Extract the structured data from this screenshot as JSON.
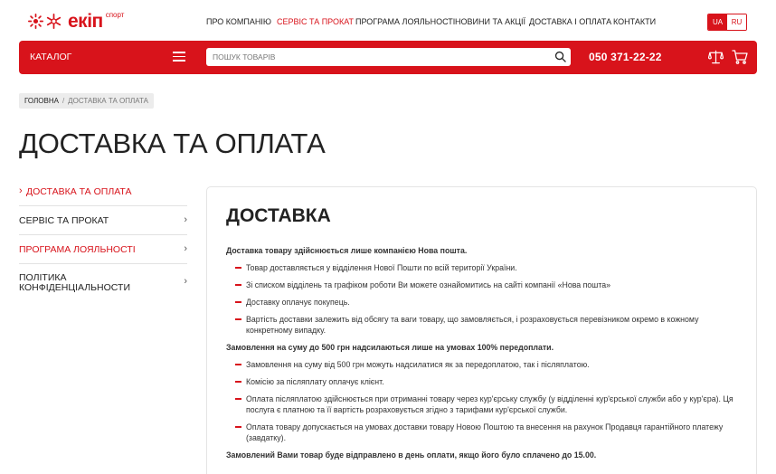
{
  "brand": {
    "name": "екіп",
    "sub": "спорт"
  },
  "topnav": [
    "ПРО КОМПАНІЮ",
    "СЕРВІС ТА ПРОКАТ",
    "ПРОГРАМА ЛОЯЛЬНОСТІ",
    "НОВИНИ ТА АКЦІЇ",
    "ДОСТАВКА І ОПЛАТА",
    "КОНТАКТИ"
  ],
  "lang": {
    "active": "UA",
    "inactive": "RU"
  },
  "bar": {
    "catalog": "КАТАЛОГ",
    "search_placeholder": "ПОШУК ТОВАРІВ",
    "phone": "050 371-22-22"
  },
  "breadcrumb": {
    "home": "ГОЛОВНА",
    "sep": "/",
    "current": "ДОСТАВКА ТА ОПЛАТА"
  },
  "page_title": "ДОСТАВКА ТА ОПЛАТА",
  "sidebar": [
    {
      "label": "ДОСТАВКА ТА ОПЛАТА"
    },
    {
      "label": "СЕРВІС ТА ПРОКАТ"
    },
    {
      "label": "ПРОГРАМА ЛОЯЛЬНОСТІ"
    },
    {
      "label": "ПОЛІТИКА КОНФІДЕНЦІАЛЬНОСТИ"
    }
  ],
  "section": {
    "title": "ДОСТАВКА",
    "lead1": "Доставка товару здійснюється лише компанією Нова пошта.",
    "list1": [
      "Товар доставляється у відділення Нової Пошти по всій території України.",
      "Зі списком відділень та графіком роботи Ви можете ознайомитись на сайті компанії «Нова пошта»",
      "Доставку оплачує покупець.",
      "Вартість доставки залежить від обсягу та ваги товару, що замовляється, і розраховується перевізником окремо в кожному конкретному випадку."
    ],
    "lead2": "Замовлення на суму до 500 грн надсилаються лише на умовах 100% передоплати.",
    "list2": [
      "Замовлення на суму від 500 грн можуть надсилатися як за передоплатою, так і післяплатою.",
      "Комісію за післяплату оплачує клієнт.",
      "Оплата післяплатою здійснюється при отриманні товару через кур'єрську службу (у відділенні кур'єрської служби або у кур'єра). Ця послуга є платною та її вартість розраховується згідно з тарифами кур'єрської служби.",
      "Оплата товару допускається на умовах доставки товару Новою Поштою та внесення на рахунок Продавця гарантійного платежу (завдатку)."
    ],
    "lead3": "Замовлений Вами товар буде відправлено в день оплати, якщо його було сплачено до 15.00."
  },
  "colors": {
    "accent": "#d8131b"
  }
}
